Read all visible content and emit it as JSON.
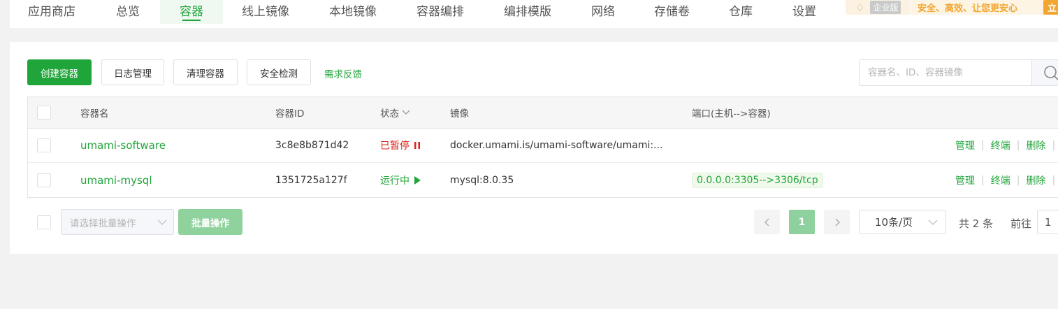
{
  "tabs": [
    {
      "label": "应用商店"
    },
    {
      "label": "总览"
    },
    {
      "label": "容器"
    },
    {
      "label": "线上镜像"
    },
    {
      "label": "本地镜像"
    },
    {
      "label": "容器编排"
    },
    {
      "label": "编排模版"
    },
    {
      "label": "网络"
    },
    {
      "label": "存储卷"
    },
    {
      "label": "仓库"
    },
    {
      "label": "设置"
    }
  ],
  "active_tab": "容器",
  "enterprise": {
    "label": "企业版",
    "slogan": "安全、高效、让您更安心",
    "button": "立"
  },
  "toolbar": {
    "create": "创建容器",
    "logs": "日志管理",
    "clean": "清理容器",
    "security": "安全检测",
    "feedback": "需求反馈"
  },
  "search": {
    "placeholder": "容器名、ID、容器镜像",
    "value": ""
  },
  "table": {
    "headers": {
      "name": "容器名",
      "id": "容器ID",
      "status": "状态",
      "image": "镜像",
      "ports": "端口(主机-->容器)"
    },
    "rows": [
      {
        "name": "umami-software",
        "id": "3c8e8b871d42",
        "status": "已暂停",
        "image": "docker.umami.is/umami-software/umami:...",
        "port": "",
        "ops": [
          "管理",
          "终端",
          "删除"
        ]
      },
      {
        "name": "umami-mysql",
        "id": "1351725a127f",
        "status": "运行中",
        "image": "mysql:8.0.35",
        "port": "0.0.0.0:3305-->3306/tcp",
        "ops": [
          "管理",
          "终端",
          "删除"
        ]
      }
    ]
  },
  "footer": {
    "batch_select_placeholder": "请选择批量操作",
    "batch_button": "批量操作",
    "current_page": "1",
    "page_size": "10条/页",
    "total": "共 2 条",
    "goto": "前往",
    "goto_value": "1"
  },
  "colors": {
    "accent": "#20a53a",
    "paused": "#e0201b",
    "enterprise": "#f2a62f"
  }
}
